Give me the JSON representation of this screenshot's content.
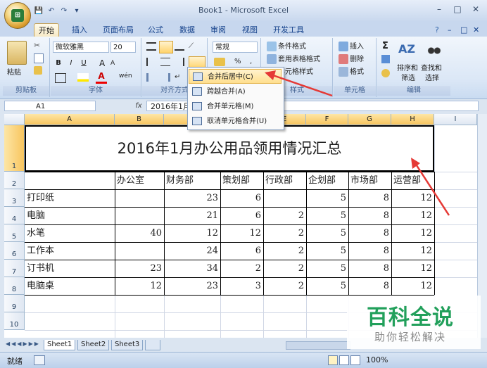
{
  "window": {
    "title": "Book1 - Microsoft Excel",
    "office_button": "⊞",
    "controls": [
      "–",
      "□",
      "✕"
    ]
  },
  "quick_access": [
    "💾",
    "↶",
    "↷",
    "▾"
  ],
  "tabs": [
    "开始",
    "插入",
    "页面布局",
    "公式",
    "数据",
    "审阅",
    "视图",
    "开发工具"
  ],
  "tab_right": [
    "?",
    "–",
    "□",
    "✕"
  ],
  "ribbon": {
    "clipboard": {
      "paste": "粘贴",
      "label": "剪贴板"
    },
    "font": {
      "name": "微软雅黑",
      "size": "20",
      "bold": "B",
      "italic": "I",
      "underline": "U",
      "grow": "A",
      "shrink": "A",
      "label": "字体",
      "wen": "wén"
    },
    "alignment": {
      "label": "对齐方式"
    },
    "number": {
      "format": "常规",
      "percent": "%",
      "comma": ","
    },
    "styles": {
      "cond": "条件格式",
      "table": "套用表格格式",
      "cell": "单元格样式",
      "label": "样式"
    },
    "cells": {
      "insert": "插入",
      "delete": "删除",
      "format": "格式",
      "label": "单元格"
    },
    "editing": {
      "sigma": "Σ",
      "sort": "排序和",
      "sort2": "筛选",
      "find": "查找和",
      "find2": "选择",
      "label": "编辑"
    }
  },
  "merge_menu": {
    "items": [
      "合并后居中(C)",
      "跨越合并(A)",
      "合并单元格(M)",
      "取消单元格合并(U)"
    ],
    "highlighted": 0
  },
  "formula_bar": {
    "name_box": "A1",
    "fx": "fx",
    "content": "2016年1月"
  },
  "columns": [
    "A",
    "B",
    "C",
    "D",
    "E",
    "F",
    "G",
    "H",
    "I"
  ],
  "rows": [
    "1",
    "2",
    "3",
    "4",
    "5",
    "6",
    "7",
    "8",
    "9",
    "10"
  ],
  "title_cell": "2016年1月办公用品领用情况汇总",
  "headers": [
    "",
    "办公室",
    "财务部",
    "策划部",
    "行政部",
    "企划部",
    "市场部",
    "运营部"
  ],
  "data_rows": [
    {
      "item": "打印纸",
      "values": [
        "",
        "23",
        "6",
        "",
        "5",
        "8",
        "12"
      ]
    },
    {
      "item": "电脑",
      "values": [
        "",
        "21",
        "6",
        "2",
        "5",
        "8",
        "12"
      ]
    },
    {
      "item": "水笔",
      "values": [
        "40",
        "12",
        "12",
        "2",
        "5",
        "8",
        "12"
      ]
    },
    {
      "item": "工作本",
      "values": [
        "",
        "24",
        "6",
        "2",
        "5",
        "8",
        "12"
      ]
    },
    {
      "item": "订书机",
      "values": [
        "23",
        "34",
        "2",
        "2",
        "5",
        "8",
        "12"
      ]
    },
    {
      "item": "电脑桌",
      "values": [
        "12",
        "23",
        "3",
        "2",
        "5",
        "8",
        "12"
      ]
    }
  ],
  "sheet_tabs": [
    "Sheet1",
    "Sheet2",
    "Sheet3"
  ],
  "status": {
    "ready": "就绪",
    "zoom": "100%"
  },
  "watermark": {
    "title": "百科全说",
    "subtitle": "助你轻松解决"
  },
  "arrow_color": "#e53935"
}
